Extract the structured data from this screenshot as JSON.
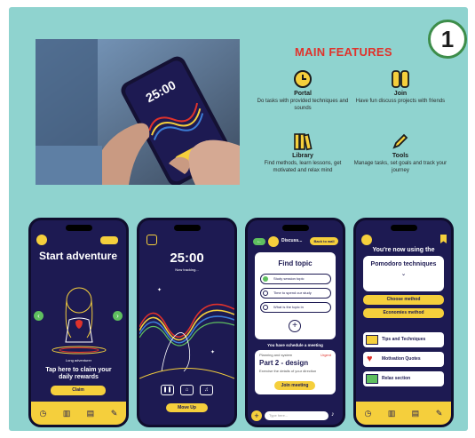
{
  "badge": {
    "number": "1"
  },
  "features": {
    "title": "MAIN FEATURES",
    "items": [
      {
        "title": "Portal",
        "desc": "Do tasks with provided techniques and sounds",
        "icon": "clock-icon"
      },
      {
        "title": "Join",
        "desc": "Have fun discuss projects with friends",
        "icon": "group-icon"
      },
      {
        "title": "Library",
        "desc": "Find methods, learn lessons, get motivated and relax mind",
        "icon": "books-icon"
      },
      {
        "title": "Tools",
        "desc": "Manage tasks, set goals and track your journey",
        "icon": "pencil-icon"
      }
    ]
  },
  "photo": {
    "timer": "25:00"
  },
  "phone1": {
    "title": "Start adventure",
    "caption": "Long adventurer",
    "claim_text": "Tap here to claim your daily rewards",
    "claim_button": "Claim"
  },
  "phone2": {
    "timer": "25:00",
    "status": "Now tracking...",
    "button": "Move Up"
  },
  "phone3": {
    "header": "Discuss...",
    "back_button": "Back to wall",
    "find_topic": "Find topic",
    "topics": [
      "Study session topic",
      "Time to spend our study",
      "What is the topic in"
    ],
    "meeting_text": "You have schedule a meeting",
    "meeting_label": "Planning and system",
    "meeting_tag": "Urgent",
    "meeting_title": "Part 2 - design",
    "meeting_desc": "Exercise the details of your direction",
    "join_button": "Join meeting",
    "input_placeholder": "Type here..."
  },
  "phone4": {
    "using_text": "You're now using the",
    "technique": "Pomodoro techniques",
    "btn1": "Choose method",
    "btn2": "Economies method",
    "links": [
      "Tips and Techniques",
      "Motivation Quotes",
      "Relax section"
    ]
  },
  "colors": {
    "accent": "#f5cf3c",
    "navy": "#1d1a52",
    "teal": "#8fd3cf",
    "red": "#e0322b"
  }
}
